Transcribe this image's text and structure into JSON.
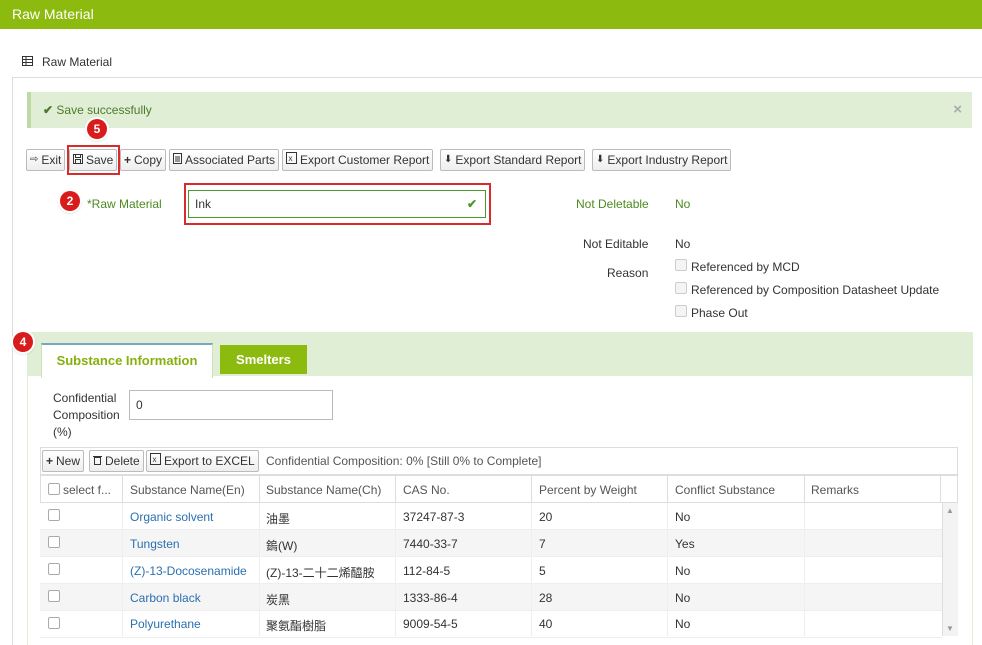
{
  "topbar": {
    "title": "Raw Material"
  },
  "panel": {
    "title": "Raw Material"
  },
  "alert": {
    "message": "Save successfully",
    "close": "×"
  },
  "toolbar": {
    "exit": "Exit",
    "save": "Save",
    "copy": "Copy",
    "associated_parts": "Associated Parts",
    "export_customer": "Export Customer Report",
    "export_standard": "Export Standard Report",
    "export_industry": "Export Industry Report"
  },
  "badges": {
    "b2": "2",
    "b4": "4",
    "b5": "5"
  },
  "form": {
    "raw_material_label": "*Raw Material",
    "raw_material_value": "Ink",
    "not_deletable_label": "Not Deletable",
    "not_deletable_value": "No",
    "not_editable_label": "Not Editable",
    "not_editable_value": "No",
    "reason_label": "Reason",
    "reasons": [
      "Referenced by MCD",
      "Referenced by Composition Datasheet Update",
      "Phase Out"
    ]
  },
  "tabs": {
    "substance": "Substance Information",
    "smelters": "Smelters"
  },
  "confidential": {
    "label_1": "Confidential",
    "label_2": "Composition",
    "label_3": "(%)",
    "value": "0"
  },
  "grid_toolbar": {
    "new": "New",
    "delete": "Delete",
    "export": "Export to EXCEL",
    "status": "Confidential Composition: 0% [Still 0% to Complete]"
  },
  "grid": {
    "headers": [
      "select f...",
      "Substance Name(En)",
      "Substance Name(Ch)",
      "CAS No.",
      "Percent by Weight",
      "Conflict Substance",
      "Remarks"
    ],
    "rows": [
      {
        "en": "Organic solvent",
        "ch": "油墨",
        "cas": "37247-87-3",
        "pct": "20",
        "conflict": "No",
        "remarks": ""
      },
      {
        "en": "Tungsten",
        "ch": "鎢(W)",
        "cas": "7440-33-7",
        "pct": "7",
        "conflict": "Yes",
        "remarks": ""
      },
      {
        "en": "(Z)-13-Docosenamide",
        "ch": "(Z)-13-二十二烯醯胺",
        "cas": "112-84-5",
        "pct": "5",
        "conflict": "No",
        "remarks": ""
      },
      {
        "en": "Carbon black",
        "ch": "炭黑",
        "cas": "1333-86-4",
        "pct": "28",
        "conflict": "No",
        "remarks": ""
      },
      {
        "en": "Polyurethane",
        "ch": "聚氨酯樹脂",
        "cas": "9009-54-5",
        "pct": "40",
        "conflict": "No",
        "remarks": ""
      }
    ]
  },
  "colors": {
    "brand": "#8cba0e",
    "highlight": "#d82b2b",
    "link": "#2a6fb0"
  }
}
